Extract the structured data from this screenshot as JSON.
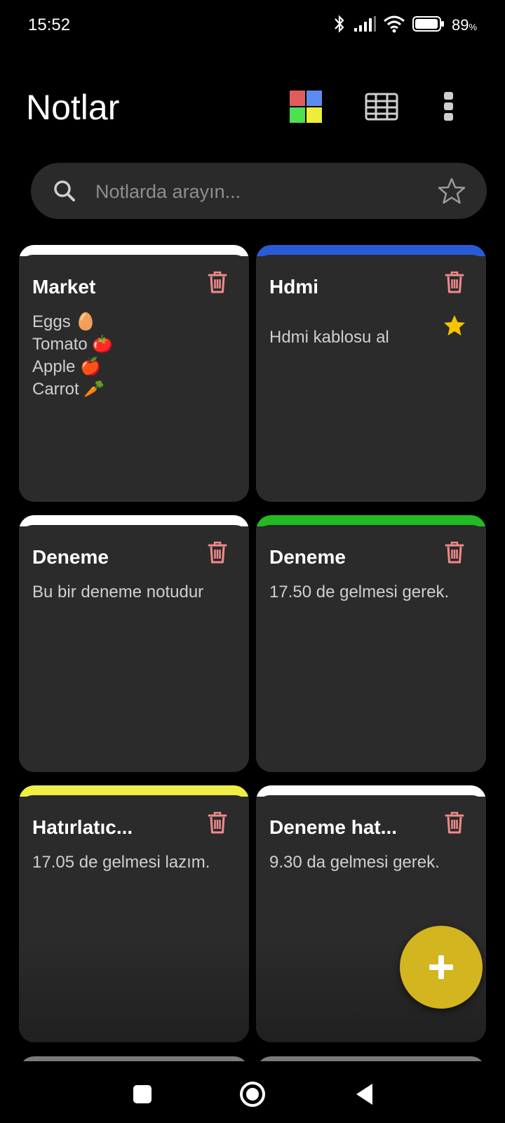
{
  "status_bar": {
    "time": "15:52",
    "battery_percent": "89",
    "battery_unit": "%",
    "icons": [
      "bluetooth-icon",
      "signal-icon",
      "wifi-icon",
      "battery-icon"
    ]
  },
  "header": {
    "title": "Notlar",
    "actions": [
      "color-filter-icon",
      "grid-view-icon",
      "more-vertical-icon"
    ]
  },
  "search": {
    "placeholder": "Notlarda arayın...",
    "value": "",
    "icons": [
      "search-icon",
      "star-outline-icon"
    ]
  },
  "notes": [
    {
      "title": "Market",
      "text": "Eggs 🥚\nTomato 🍅\nApple 🍎\nCarrot 🥕",
      "color": "#ffffff",
      "starred": false
    },
    {
      "title": "Hdmi",
      "text": "Hdmi kablosu al",
      "color": "#2a5bd7",
      "starred": true
    },
    {
      "title": "Deneme",
      "text": "Bu bir deneme notudur",
      "color": "#ffffff",
      "starred": false
    },
    {
      "title": "Deneme",
      "text": "17.50 de gelmesi gerek.",
      "color": "#22bb22",
      "starred": false
    },
    {
      "title": "Hatırlatıc...",
      "text": "17.05 de gelmesi lazım.",
      "color": "#eeee44",
      "starred": false
    },
    {
      "title": "Deneme hat...",
      "text": "9.30 da gelmesi gerek.",
      "color": "#ffffff",
      "starred": false
    }
  ],
  "colors": {
    "background": "#000000",
    "card": "#2b2b2b",
    "delete": "#f08a8a",
    "star": "#f5c400",
    "fab": "#d2b51f"
  },
  "fab": {
    "icon": "plus-icon"
  },
  "nav_bar": {
    "buttons": [
      "recents-icon",
      "home-icon",
      "back-icon"
    ]
  }
}
